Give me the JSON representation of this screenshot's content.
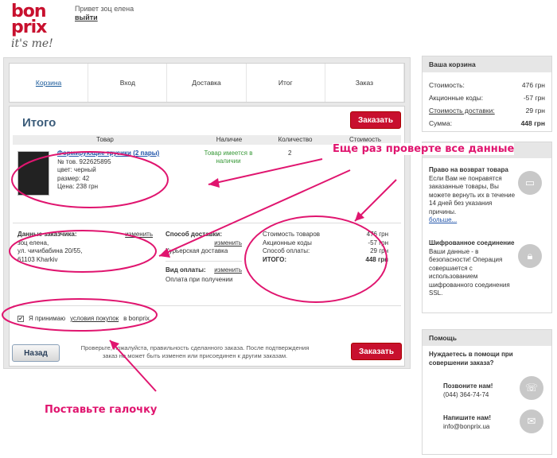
{
  "brand": {
    "name": "bon prix",
    "tagline": "it's me!"
  },
  "user": {
    "greeting": "Привет зоц елена",
    "logout": "выйти"
  },
  "steps": [
    "Корзина",
    "Вход",
    "Доставка",
    "Итог",
    "Заказ"
  ],
  "page_title": "Итого",
  "order_button": "Заказать",
  "columns": [
    "Товар",
    "Наличие",
    "Количество",
    "Стоимость"
  ],
  "product": {
    "name": "Формирующие трусики (2 пары)",
    "article": "№ тов. 922625895",
    "color": "цвет: черный",
    "size": "размер: 42",
    "price": "Цена: 238 грн",
    "availability": "Товар имеется в наличии",
    "quantity": "2"
  },
  "customer": {
    "label": "Данные заказчика:",
    "edit": "изменить",
    "name": "зоц елена,",
    "street": "ул. чичибабина 20/55,",
    "city": "61103 Kharkiv"
  },
  "delivery": {
    "label": "Способ доставки:",
    "edit": "изменить",
    "value": "Курьерская доставка",
    "payment_label": "Вид оплаты:",
    "payment_edit": "изменить",
    "payment_value": "Оплата при получении"
  },
  "summary": [
    {
      "label": "Стоимость товаров",
      "value": "476 грн"
    },
    {
      "label": "Акционные коды",
      "value": "-57 грн"
    },
    {
      "label": "Способ оплаты:",
      "value": "29 грн"
    },
    {
      "label": "ИТОГО:",
      "value": "448 грн"
    }
  ],
  "terms": {
    "prefix": "Я принимаю",
    "link": "условия покупок",
    "suffix": "в bonprix."
  },
  "back_button": "Назад",
  "note": "Проверьте, пожалуйста, правильность сделанного заказа. После подтверждения заказ не может быть изменен или присоединен к другим заказам.",
  "cart": {
    "title": "Ваша корзина",
    "rows": [
      {
        "label": "Стоимость:",
        "value": "476 грн"
      },
      {
        "label": "Акционные коды:",
        "value": "-57 грн"
      },
      {
        "label": "Стоимость доставки:",
        "value": "29 грн"
      },
      {
        "label": "Сумма:",
        "value": "448 грн"
      }
    ]
  },
  "return_info": {
    "title": "Право на возврат товара",
    "text": "Если Вам не понравятся заказанные товары, Вы можете вернуть их в течение 14 дней без указания причины.",
    "more": "больше..."
  },
  "ssl_info": {
    "title": "Шифрованное соединение",
    "text": "Ваши данные - в безопасности! Операция совершается с использованием шифрованного соединения SSL."
  },
  "help": {
    "title": "Помощь",
    "question": "Нуждаетесь в помощи при совершении заказа?",
    "call_label": "Позвоните нам!",
    "phone": "(044) 364-74-74",
    "write_label": "Напишите нам!",
    "email": "info@bonprix.ua"
  },
  "callouts": {
    "check_all": "Еще раз проверте все данные",
    "tick_box": "Поставьте галочку"
  },
  "colors": {
    "brand_red": "#c8102e",
    "annotation_pink": "#e0156f",
    "title_blue": "#3b5c7a"
  }
}
